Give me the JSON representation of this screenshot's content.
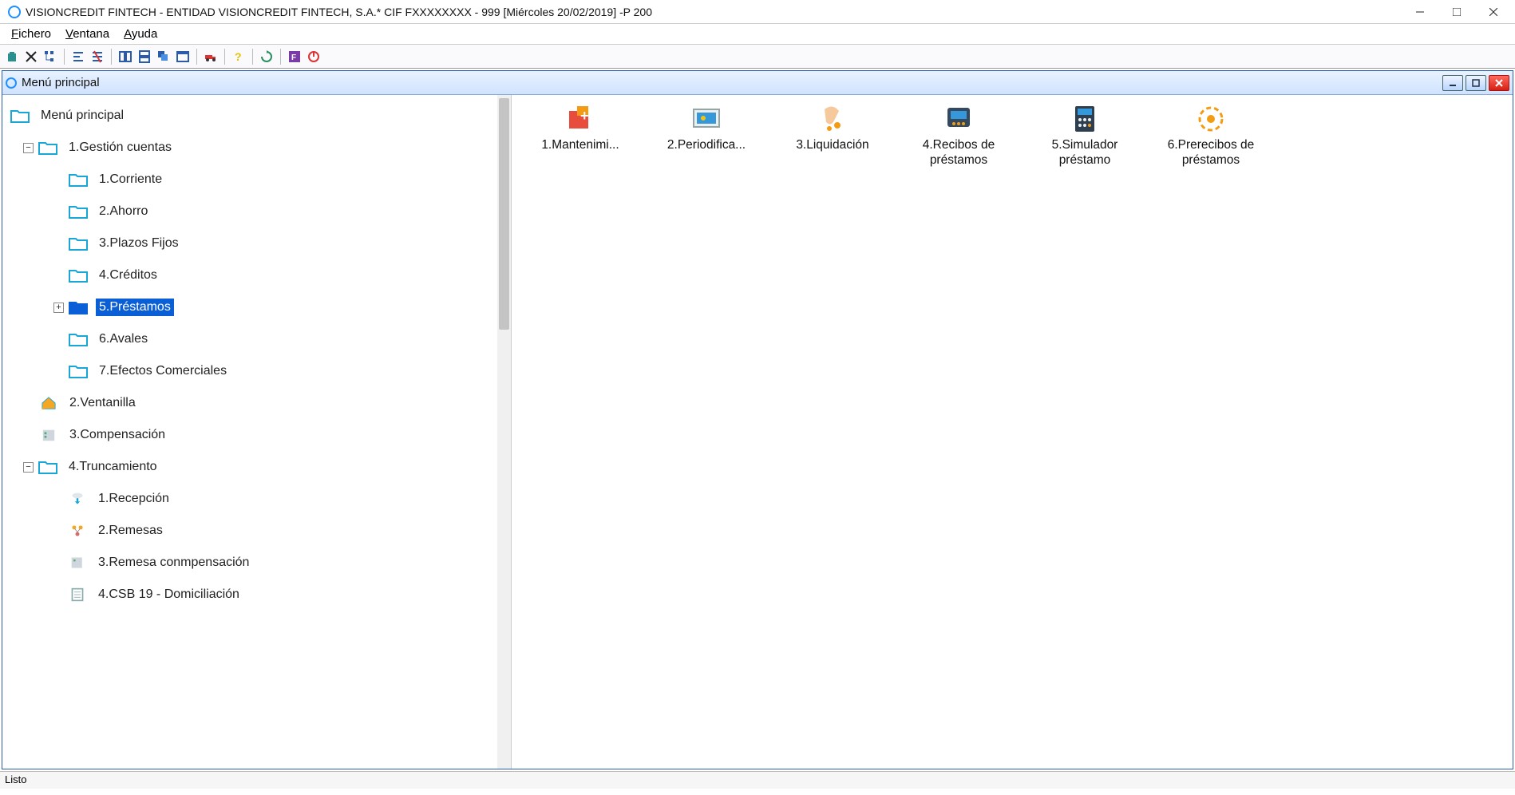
{
  "window": {
    "title": "VISIONCREDIT FINTECH - ENTIDAD VISIONCREDIT FINTECH, S.A.* CIF FXXXXXXXX - 999 [Miércoles 20/02/2019] -P 200"
  },
  "menubar": {
    "file": "Fichero",
    "window": "Ventana",
    "help": "Ayuda"
  },
  "toolbar_icons": [
    "trash",
    "delete",
    "tree",
    "align-left",
    "align-strike",
    "columns",
    "rows",
    "cascade",
    "window",
    "truck",
    "help",
    "refresh",
    "panel-f",
    "power"
  ],
  "child": {
    "title": "Menú principal"
  },
  "tree": {
    "root": "Menú principal",
    "n1": {
      "label": "1.Gestión cuentas",
      "expanded": true,
      "children": [
        {
          "label": "1.Corriente"
        },
        {
          "label": "2.Ahorro"
        },
        {
          "label": "3.Plazos Fijos"
        },
        {
          "label": "4.Créditos"
        },
        {
          "label": "5.Préstamos",
          "selected": true,
          "expandable": true
        },
        {
          "label": "6.Avales"
        },
        {
          "label": "7.Efectos Comerciales"
        }
      ]
    },
    "n2": {
      "label": "2.Ventanilla"
    },
    "n3": {
      "label": "3.Compensación"
    },
    "n4": {
      "label": "4.Truncamiento",
      "expanded": true,
      "children": [
        {
          "label": "1.Recepción"
        },
        {
          "label": "2.Remesas"
        },
        {
          "label": "3.Remesa conmpensación"
        },
        {
          "label": "4.CSB 19 - Domiciliación"
        }
      ]
    }
  },
  "grid": [
    {
      "label": "1.Mantenimi...",
      "icon": "maint"
    },
    {
      "label": "2.Periodifica...",
      "icon": "period"
    },
    {
      "label": "3.Liquidación",
      "icon": "liquid"
    },
    {
      "label": "4.Recibos de préstamos",
      "icon": "receipt"
    },
    {
      "label": "5.Simulador préstamo",
      "icon": "calc"
    },
    {
      "label": "6.Prerecibos de préstamos",
      "icon": "prereceipt"
    }
  ],
  "status": "Listo"
}
